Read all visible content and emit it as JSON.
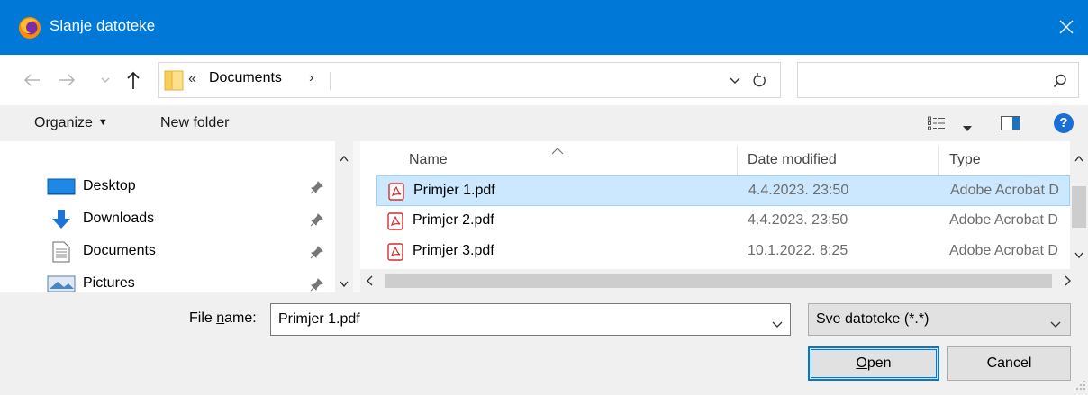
{
  "window": {
    "title": "Slanje datoteke",
    "app_icon": "firefox-icon",
    "close_icon": "close-icon"
  },
  "navigation": {
    "back_icon": "arrow-left-icon",
    "forward_icon": "arrow-right-icon",
    "recent_icon": "chevron-down-icon",
    "up_icon": "arrow-up-icon",
    "address": {
      "prefix": "«",
      "path": "Documents",
      "suffix": "›"
    },
    "refresh_icon": "refresh-icon",
    "search": {
      "placeholder": "",
      "icon": "search-icon"
    }
  },
  "command_bar": {
    "organize_label": "Organize",
    "new_folder_label": "New folder"
  },
  "nav_pane": {
    "items": [
      {
        "label": "Desktop",
        "icon": "desktop-icon"
      },
      {
        "label": "Downloads",
        "icon": "download-icon"
      },
      {
        "label": "Documents",
        "icon": "document-icon"
      },
      {
        "label": "Pictures",
        "icon": "pictures-icon"
      }
    ]
  },
  "file_list": {
    "columns": {
      "name": "Name",
      "date": "Date modified",
      "type": "Type"
    },
    "rows": [
      {
        "name": "Primjer 1.pdf",
        "date": "4.4.2023. 23:50",
        "type": "Adobe Acrobat D",
        "selected": true
      },
      {
        "name": "Primjer 2.pdf",
        "date": "4.4.2023. 23:50",
        "type": "Adobe Acrobat D",
        "selected": false
      },
      {
        "name": "Primjer 3.pdf",
        "date": "10.1.2022. 8:25",
        "type": "Adobe Acrobat D",
        "selected": false
      }
    ]
  },
  "footer": {
    "file_name_label_pre": "File ",
    "file_name_label_accel": "n",
    "file_name_label_post": "ame:",
    "file_name_value": "Primjer 1.pdf",
    "file_type_value": "Sve datoteke (*.*)",
    "open_accel": "O",
    "open_rest": "pen",
    "cancel_label": "Cancel"
  },
  "colors": {
    "title_bar": "#0078d7",
    "selection": "#cce8ff",
    "pdf_red": "#d32f2f"
  }
}
